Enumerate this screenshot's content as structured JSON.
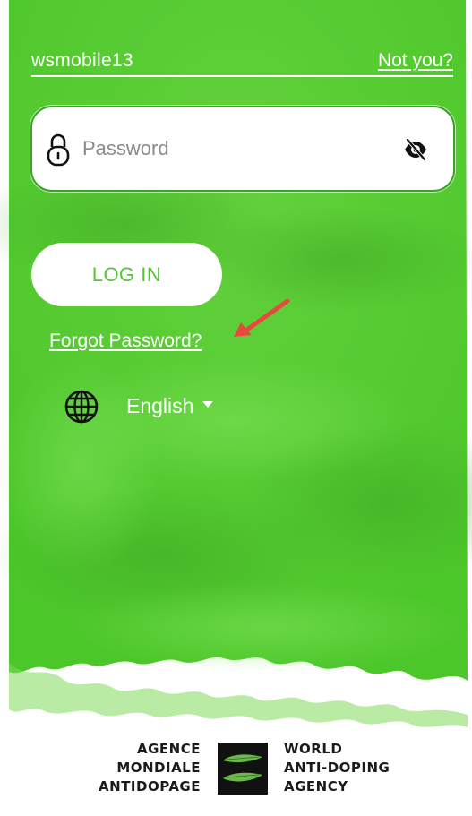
{
  "account": {
    "username": "wsmobile13",
    "not_you_label": "Not you?"
  },
  "password_field": {
    "placeholder": "Password",
    "value": "",
    "lock_icon": "lock-icon",
    "visibility_icon": "eye-off-icon"
  },
  "login_button_label": "LOG IN",
  "forgot_password_label": "Forgot Password?",
  "language": {
    "icon": "globe-icon",
    "selected": "English"
  },
  "annotation_arrow_color": "#e8483e",
  "logo": {
    "left_lines": [
      "AGENCE",
      "MONDIALE",
      "ANTIDOPAGE"
    ],
    "right_lines": [
      "WORLD",
      "ANTI-DOPING",
      "AGENCY"
    ]
  },
  "colors": {
    "background_green": "#5cd33a",
    "border_green": "#3aa226",
    "button_text_green": "#58c43a",
    "text_white": "#ffffff"
  }
}
